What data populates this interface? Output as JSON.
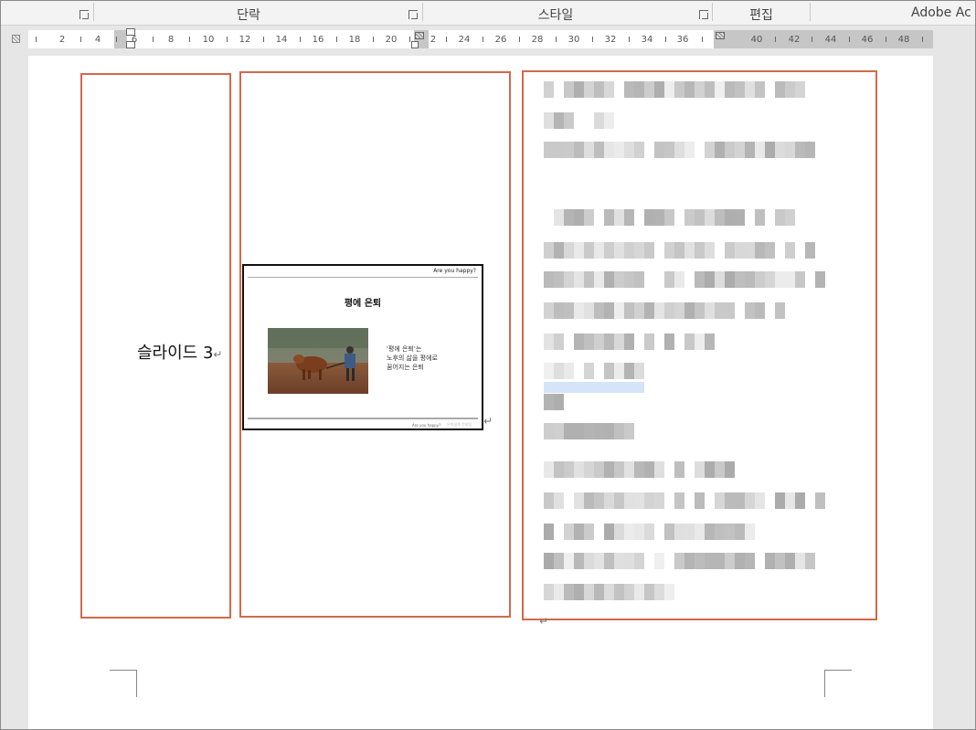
{
  "ribbon": {
    "groups": [
      {
        "label": ""
      },
      {
        "label": "단락"
      },
      {
        "label": "스타일"
      },
      {
        "label": "편집"
      },
      {
        "label": "Adobe Ac"
      }
    ]
  },
  "ruler": {
    "ticks": [
      "2",
      "4",
      "6",
      "8",
      "10",
      "12",
      "14",
      "16",
      "18",
      "20",
      "2",
      "24",
      "26",
      "28",
      "30",
      "32",
      "34",
      "36",
      "40",
      "42",
      "44",
      "46",
      "48"
    ]
  },
  "document": {
    "column1_label": "슬라이드 3",
    "paragraph_mark": "↵",
    "slide": {
      "header_tag": "Are you happy?",
      "title": "평에 은퇴",
      "photo_alt": "farmer plowing with ox",
      "body_lines": [
        "'평에 은퇴'는",
        "노후의 삶을 평에로",
        "꿈어지는 은퇴"
      ],
      "footer_left": "Are you happy?",
      "footer_right": "은퇴설계 컨설팅"
    }
  },
  "colors": {
    "column_border": "#d3694b",
    "ruler_gray": "#c6c6c6"
  }
}
